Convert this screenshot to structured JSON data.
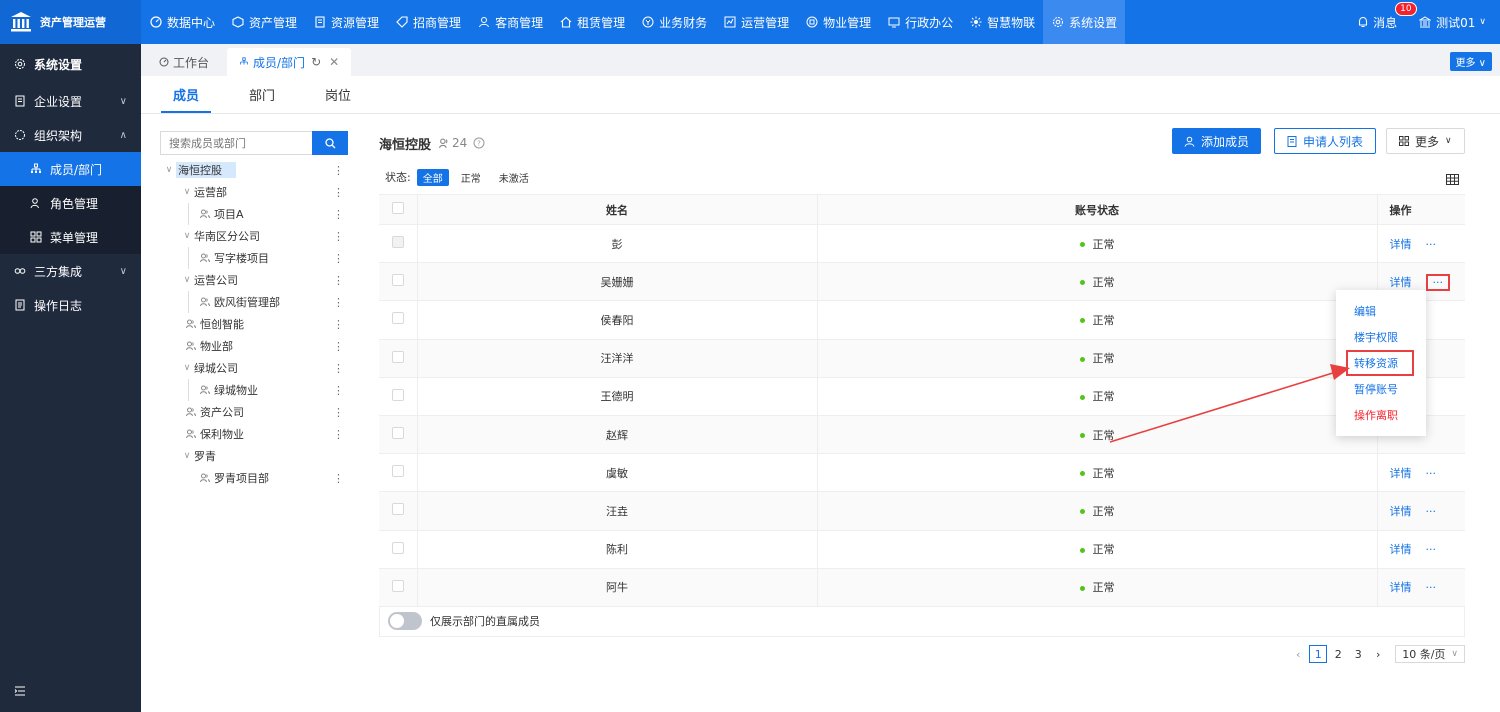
{
  "app": {
    "title": "资产管理运营"
  },
  "nav": [
    {
      "label": "数据中心",
      "icon": "dashboard-icon"
    },
    {
      "label": "资产管理",
      "icon": "cube-icon"
    },
    {
      "label": "资源管理",
      "icon": "building-icon"
    },
    {
      "label": "招商管理",
      "icon": "tag-icon"
    },
    {
      "label": "客商管理",
      "icon": "users-icon"
    },
    {
      "label": "租赁管理",
      "icon": "home-icon"
    },
    {
      "label": "业务财务",
      "icon": "money-icon"
    },
    {
      "label": "运营管理",
      "icon": "chart-icon"
    },
    {
      "label": "物业管理",
      "icon": "property-icon"
    },
    {
      "label": "行政办公",
      "icon": "office-icon"
    },
    {
      "label": "智慧物联",
      "icon": "iot-icon"
    },
    {
      "label": "系统设置",
      "icon": "gear-icon"
    }
  ],
  "topright": {
    "messages_label": "消息",
    "messages_count": "10",
    "user_label": "测试01"
  },
  "sidebar": {
    "title": "系统设置",
    "items": [
      {
        "label": "企业设置"
      },
      {
        "label": "组织架构"
      },
      {
        "label": "成员/部门"
      },
      {
        "label": "角色管理"
      },
      {
        "label": "菜单管理"
      },
      {
        "label": "三方集成"
      },
      {
        "label": "操作日志"
      }
    ]
  },
  "pagetabs": {
    "workbench": "工作台",
    "current": "成员/部门",
    "more": "更多"
  },
  "subtabs": [
    "成员",
    "部门",
    "岗位"
  ],
  "tree": {
    "search_placeholder": "搜索成员或部门",
    "nodes": [
      {
        "label": "海恒控股"
      },
      {
        "label": "运营部"
      },
      {
        "label": "项目A"
      },
      {
        "label": "华南区分公司"
      },
      {
        "label": "写字楼项目"
      },
      {
        "label": "运营公司"
      },
      {
        "label": "欧风街管理部"
      },
      {
        "label": "恒创智能"
      },
      {
        "label": "物业部"
      },
      {
        "label": "绿城公司"
      },
      {
        "label": "绿城物业"
      },
      {
        "label": "资产公司"
      },
      {
        "label": "保利物业"
      },
      {
        "label": "罗青"
      },
      {
        "label": "罗青项目部"
      }
    ]
  },
  "content": {
    "title": "海恒控股",
    "count": "24",
    "add_member": "添加成员",
    "applicants": "申请人列表",
    "more": "更多",
    "status_label": "状态:",
    "filters": [
      "全部",
      "正常",
      "未激活"
    ]
  },
  "table": {
    "headers": {
      "name": "姓名",
      "status": "账号状态",
      "op": "操作"
    },
    "detail_label": "详情",
    "more_label": "···",
    "rows": [
      {
        "name": "彭",
        "status": "正常"
      },
      {
        "name": "吴姗姗",
        "status": "正常"
      },
      {
        "name": "侯春阳",
        "status": "正常"
      },
      {
        "name": "汪洋洋",
        "status": "正常"
      },
      {
        "name": "王德明",
        "status": "正常"
      },
      {
        "name": "赵辉",
        "status": "正常"
      },
      {
        "name": "虞敏",
        "status": "正常"
      },
      {
        "name": "汪垚",
        "status": "正常"
      },
      {
        "name": "陈利",
        "status": "正常"
      },
      {
        "name": "阿牛",
        "status": "正常"
      }
    ]
  },
  "switch_label": "仅展示部门的直属成员",
  "pager": {
    "pages": [
      "1",
      "2",
      "3"
    ],
    "size": "10 条/页"
  },
  "dropdown": [
    "编辑",
    "楼宇权限",
    "转移资源",
    "暂停账号",
    "操作离职"
  ],
  "colors": {
    "primary": "#1473e6",
    "sidebar": "#1f2a3d",
    "danger": "#f5222d",
    "highlight": "#e84040",
    "success": "#52c41a"
  }
}
